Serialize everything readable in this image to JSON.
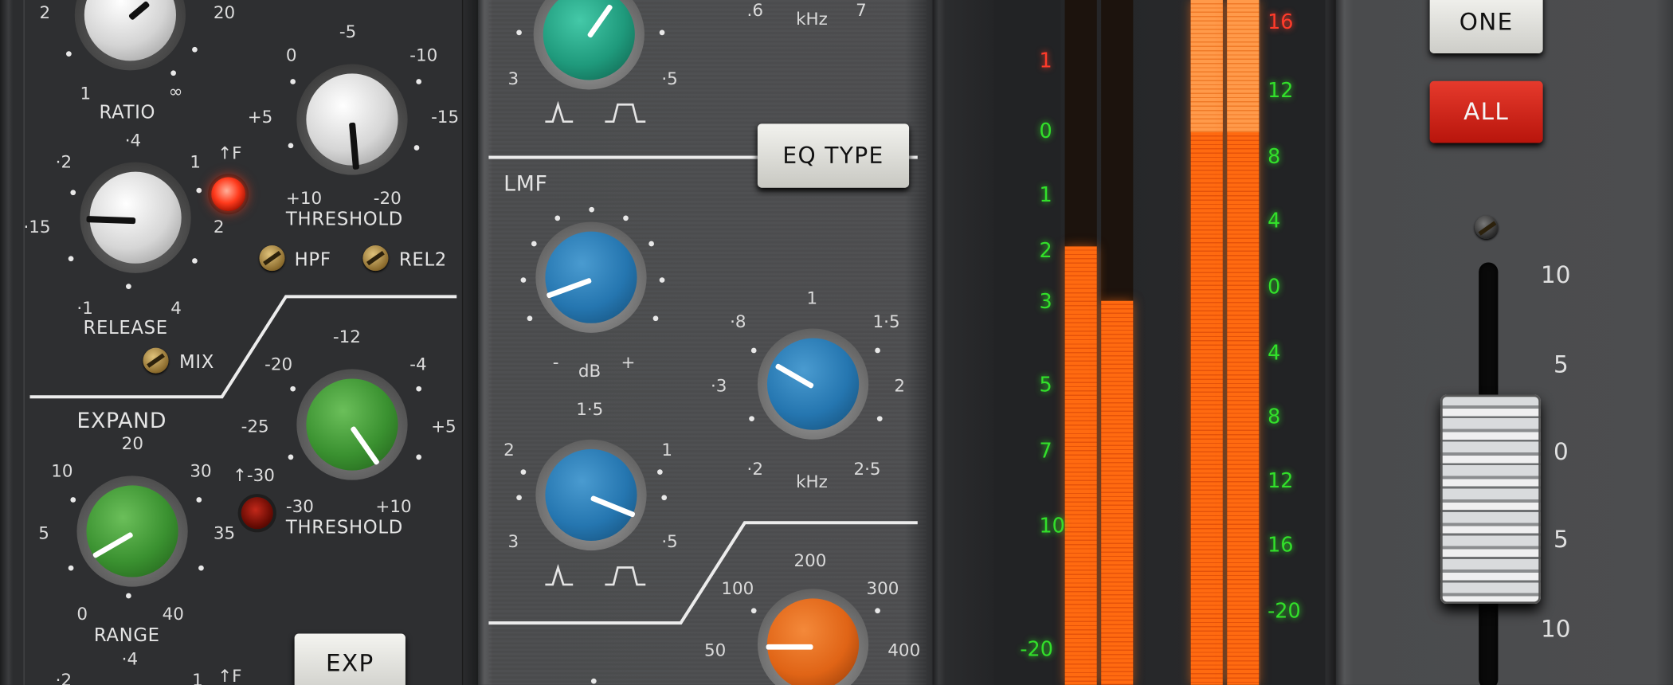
{
  "dynamics": {
    "top_left_knob_labels": {
      "left": "2",
      "right": "20"
    },
    "ratio": {
      "label": "RATIO",
      "min": "1",
      "max": "∞"
    },
    "release": {
      "label": "RELEASE",
      "ticks": [
        "·4",
        "·2",
        "1",
        "·15",
        "2",
        "·1",
        "4"
      ]
    },
    "fast_attack_label": "↑F",
    "threshold": {
      "label": "THRESHOLD",
      "ticks": [
        "-5",
        "0",
        "-10",
        "+5",
        "-15",
        "+10",
        "-20"
      ]
    },
    "hpf_label": "HPF",
    "rel2_label": "REL2",
    "mix_label": "MIX",
    "expand": {
      "label": "EXPAND",
      "range_label": "RANGE",
      "range_ticks": [
        "20",
        "10",
        "30",
        "5",
        "35",
        "0",
        "40"
      ],
      "threshold_label": "THRESHOLD",
      "threshold_ticks": [
        "-12",
        "-20",
        "-4",
        "-25",
        "+5",
        "-30",
        "+10"
      ],
      "led_label": "↑-30"
    },
    "exp_button": "EXP",
    "bottom_ticks": [
      "·4",
      "·2",
      "1",
      "↑F"
    ]
  },
  "eq": {
    "hmf_ticks": [
      "3",
      "·5"
    ],
    "hmf_freq_partial": [
      ".6",
      "7"
    ],
    "hmf_unit": "kHz",
    "eq_type_button": "EQ TYPE",
    "lmf": {
      "label": "LMF",
      "gain_ticks": [
        "-",
        "dB",
        "+"
      ],
      "freq_ticks": [
        "1",
        "·8",
        "1·5",
        "·3",
        "2",
        "·2",
        "2·5"
      ],
      "freq_unit": "kHz",
      "q_ticks": [
        "1·5",
        "2",
        "1",
        "3",
        "·5"
      ]
    },
    "lf_freq_ticks": [
      "200",
      "100",
      "300",
      "50",
      "400"
    ]
  },
  "meters": {
    "left_scale": [
      "1",
      "0",
      "1",
      "2",
      "3",
      "5",
      "7",
      "10",
      "-20"
    ],
    "right_scale": [
      "16",
      "12",
      "8",
      "4",
      "0",
      "4",
      "8",
      "12",
      "16",
      "-20"
    ],
    "bar_levels": [
      0.64,
      0.56,
      1.0,
      1.0
    ],
    "led_green": "#32e02a",
    "led_red": "#ff3b2a",
    "bar_color": "#ff6a10"
  },
  "fader": {
    "one_button": "ONE",
    "all_button": "ALL",
    "scale": [
      "10",
      "5",
      "0",
      "5",
      "10"
    ],
    "level_fraction": 0.38
  }
}
